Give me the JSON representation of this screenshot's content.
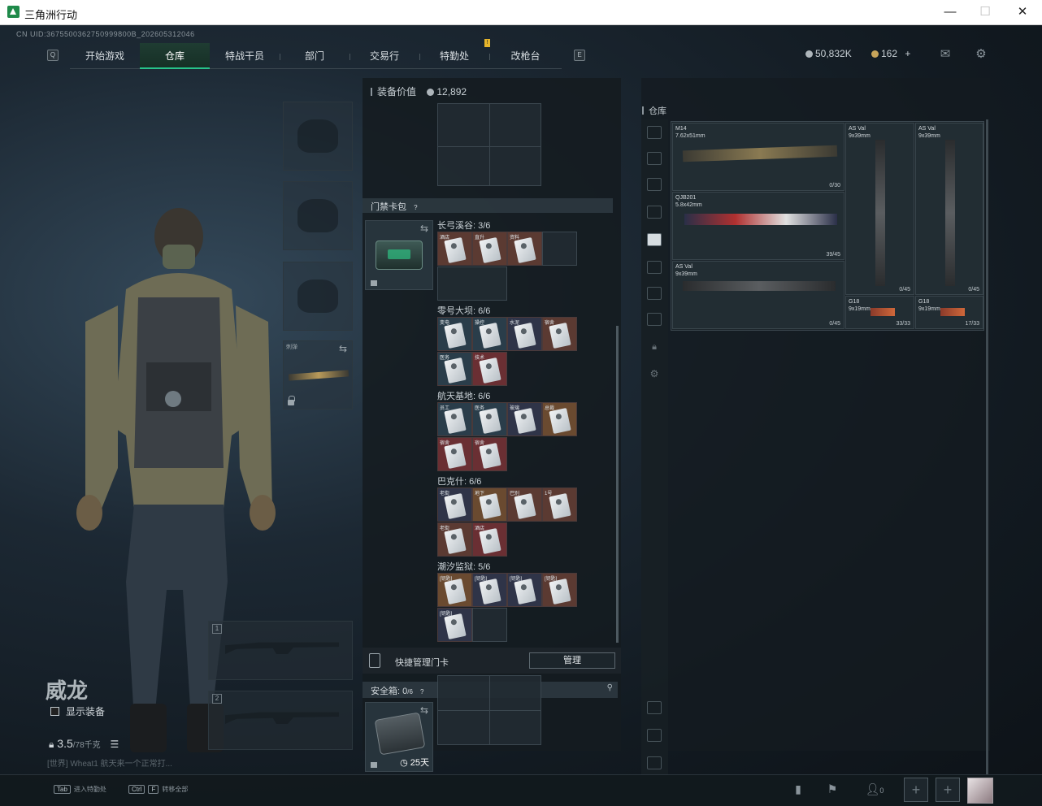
{
  "window": {
    "title": "三角洲行动",
    "minimize": "—",
    "maximize": "☐",
    "close": "✕"
  },
  "header": {
    "uid": "CN UID:3675500362750999800B_202605312046",
    "tabs": [
      {
        "label": "开始游戏",
        "active": false
      },
      {
        "label": "仓库",
        "active": true
      },
      {
        "label": "特战干员",
        "active": false
      },
      {
        "label": "部门",
        "active": false
      },
      {
        "label": "交易行",
        "active": false
      },
      {
        "label": "特勤处",
        "active": false
      },
      {
        "label": "改枪台",
        "active": false
      }
    ],
    "left_key": "Q",
    "right_key": "E",
    "badge": "!",
    "currency_silver": "50,832K",
    "currency_gold": "162",
    "gold_plus": "+",
    "mail_icon": "✉",
    "settings_icon": "⚙"
  },
  "character": {
    "name": "威龙",
    "show_equipment_label": "显示装备",
    "weight_value": "3.5",
    "weight_max": "/78千克",
    "list_icon": "☰",
    "chat_line": "[世界] Wheat1 航天来一个正常打...",
    "sling_label": "刺弹",
    "weapon_slot_1": "1",
    "weapon_slot_2": "2"
  },
  "equipment_panel": {
    "value_label": "装备价值",
    "value": "12,892",
    "keycard_section": "门禁卡包",
    "keycard_help": "?",
    "sets": [
      {
        "label": "长弓溪谷: 3/6",
        "cards": [
          "酒店",
          "直升",
          "资料"
        ]
      },
      {
        "label": "零号大坝: 6/6",
        "cards": [
          "变电",
          "操控",
          "水泥",
          "宿舍",
          "医务",
          "技术"
        ]
      },
      {
        "label": "航天基地: 6/6",
        "cards": [
          "员工",
          "医务",
          "玻璃",
          "总裁",
          "宿舍",
          "宿舍"
        ]
      },
      {
        "label": "巴克什: 6/6",
        "cards": [
          "老街",
          "地下",
          "巴别",
          "1号",
          "老街",
          "酒店"
        ]
      },
      {
        "label": "潮汐监狱: 5/6",
        "cards": [
          "[钥匙]",
          "[钥匙]",
          "[钥匙]",
          "[钥匙]",
          "[钥匙]"
        ]
      }
    ],
    "quick_manage_label": "快捷管理门卡",
    "manage_button": "管理",
    "safe_box_label": "安全箱:",
    "safe_box_value": "0",
    "safe_box_max": "/6",
    "safe_help": "?",
    "safe_pin": "⚲",
    "safe_days": "25天"
  },
  "warehouse": {
    "label": "仓库",
    "weapons": [
      {
        "name": "M14",
        "caliber": "7.62x51mm",
        "ammo": "0/30"
      },
      {
        "name": "QJB201",
        "caliber": "5.8x42mm",
        "ammo": "39/45"
      },
      {
        "name": "AS Val",
        "caliber": "9x39mm",
        "ammo": "0/45"
      },
      {
        "name": "AS Val",
        "caliber": "9x39mm",
        "ammo": "0/45"
      },
      {
        "name": "AS Val",
        "caliber": "9x39mm",
        "ammo": "0/45"
      },
      {
        "name": "G18",
        "caliber": "9x19mm",
        "ammo": "33/33"
      },
      {
        "name": "G18",
        "caliber": "9x19mm",
        "ammo": "17/33"
      }
    ]
  },
  "bottom": {
    "tab_key": "Tab",
    "tab_hint": "进入特勤处",
    "ctrl_key": "Ctrl",
    "f_key": "F",
    "ctrl_hint": "转移全部",
    "stats_icon": "▮",
    "flag_icon": "⚑",
    "friends_count": "0",
    "plus": "+"
  }
}
